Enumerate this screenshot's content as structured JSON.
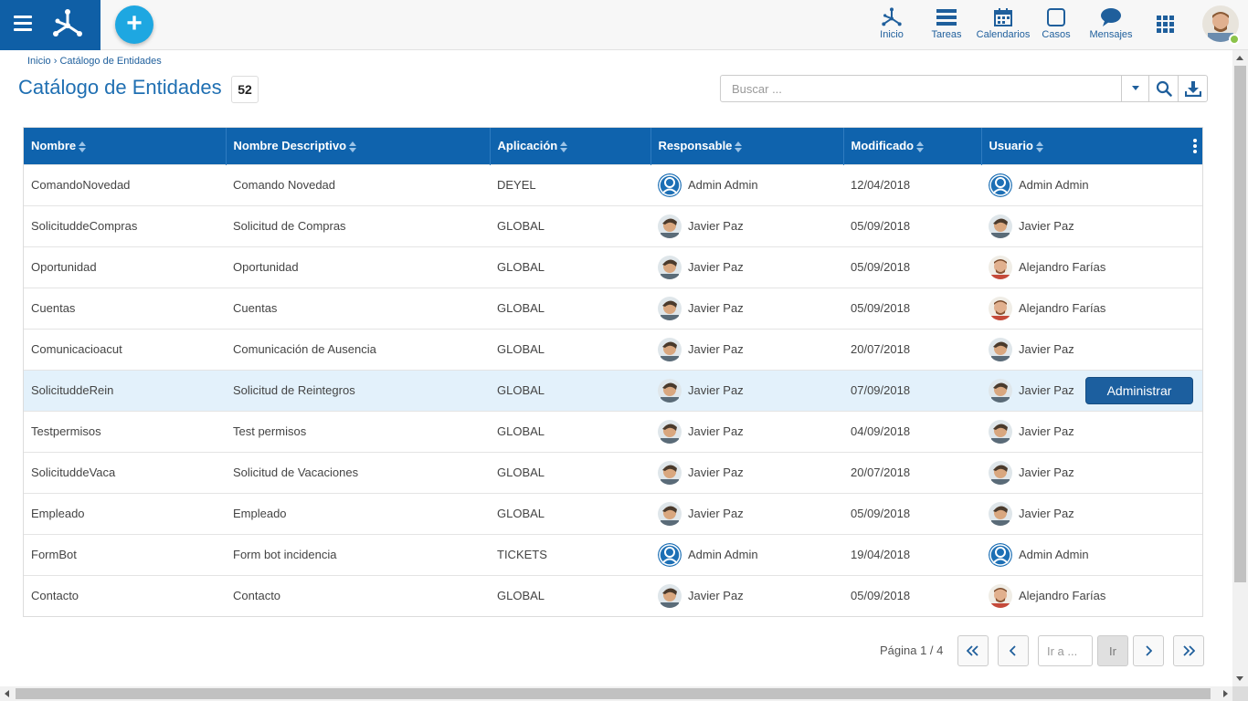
{
  "nav": {
    "items": [
      {
        "label": "Inicio",
        "icon": "logo-network-icon"
      },
      {
        "label": "Tareas",
        "icon": "tasks-list-icon"
      },
      {
        "label": "Calendarios",
        "icon": "calendar-icon"
      },
      {
        "label": "Casos",
        "icon": "cases-square-icon"
      },
      {
        "label": "Mensajes",
        "icon": "chat-bubble-icon"
      }
    ]
  },
  "breadcrumb": {
    "home": "Inicio",
    "separator": "›",
    "current": "Catálogo de Entidades"
  },
  "page": {
    "title": "Catálogo de Entidades",
    "count": "52"
  },
  "search": {
    "placeholder": "Buscar ..."
  },
  "table": {
    "headers": [
      "Nombre",
      "Nombre Descriptivo",
      "Aplicación",
      "Responsable",
      "Modificado",
      "Usuario"
    ],
    "rows": [
      {
        "nombre": "ComandoNovedad",
        "descriptivo": "Comando Novedad",
        "aplicacion": "DEYEL",
        "responsable": "Admin Admin",
        "resp_avatar": "admin",
        "modificado": "12/04/2018",
        "usuario": "Admin Admin",
        "usr_avatar": "admin"
      },
      {
        "nombre": "SolicituddeCompras",
        "descriptivo": "Solicitud de Compras",
        "aplicacion": "GLOBAL",
        "responsable": "Javier Paz",
        "resp_avatar": "javier",
        "modificado": "05/09/2018",
        "usuario": "Javier Paz",
        "usr_avatar": "javier"
      },
      {
        "nombre": "Oportunidad",
        "descriptivo": "Oportunidad",
        "aplicacion": "GLOBAL",
        "responsable": "Javier Paz",
        "resp_avatar": "javier",
        "modificado": "05/09/2018",
        "usuario": "Alejandro Farías",
        "usr_avatar": "alejandro"
      },
      {
        "nombre": "Cuentas",
        "descriptivo": "Cuentas",
        "aplicacion": "GLOBAL",
        "responsable": "Javier Paz",
        "resp_avatar": "javier",
        "modificado": "05/09/2018",
        "usuario": "Alejandro Farías",
        "usr_avatar": "alejandro"
      },
      {
        "nombre": "Comunicacioacut",
        "descriptivo": "Comunicación de Ausencia",
        "aplicacion": "GLOBAL",
        "responsable": "Javier Paz",
        "resp_avatar": "javier",
        "modificado": "20/07/2018",
        "usuario": "Javier Paz",
        "usr_avatar": "javier"
      },
      {
        "nombre": "SolicituddeRein",
        "descriptivo": "Solicitud de Reintegros",
        "aplicacion": "GLOBAL",
        "responsable": "Javier Paz",
        "resp_avatar": "javier",
        "modificado": "07/09/2018",
        "usuario": "Javier Paz",
        "usr_avatar": "javier",
        "selected": true
      },
      {
        "nombre": "Testpermisos",
        "descriptivo": "Test permisos",
        "aplicacion": "GLOBAL",
        "responsable": "Javier Paz",
        "resp_avatar": "javier",
        "modificado": "04/09/2018",
        "usuario": "Javier Paz",
        "usr_avatar": "javier"
      },
      {
        "nombre": "SolicituddeVaca",
        "descriptivo": "Solicitud de Vacaciones",
        "aplicacion": "GLOBAL",
        "responsable": "Javier Paz",
        "resp_avatar": "javier",
        "modificado": "20/07/2018",
        "usuario": "Javier Paz",
        "usr_avatar": "javier"
      },
      {
        "nombre": "Empleado",
        "descriptivo": "Empleado",
        "aplicacion": "GLOBAL",
        "responsable": "Javier Paz",
        "resp_avatar": "javier",
        "modificado": "05/09/2018",
        "usuario": "Javier Paz",
        "usr_avatar": "javier"
      },
      {
        "nombre": "FormBot",
        "descriptivo": "Form bot incidencia",
        "aplicacion": "TICKETS",
        "responsable": "Admin Admin",
        "resp_avatar": "admin",
        "modificado": "19/04/2018",
        "usuario": "Admin Admin",
        "usr_avatar": "admin"
      },
      {
        "nombre": "Contacto",
        "descriptivo": "Contacto",
        "aplicacion": "GLOBAL",
        "responsable": "Javier Paz",
        "resp_avatar": "javier",
        "modificado": "05/09/2018",
        "usuario": "Alejandro Farías",
        "usr_avatar": "alejandro"
      }
    ],
    "row_action": "Administrar"
  },
  "pagination": {
    "label": "Página 1 / 4",
    "goto_placeholder": "Ir a ...",
    "go_label": "Ir"
  },
  "colors": {
    "brand": "#0f5fa6",
    "header": "#0f63ad",
    "accent": "#1ea7e1",
    "selected_row": "#e3f1fb"
  }
}
